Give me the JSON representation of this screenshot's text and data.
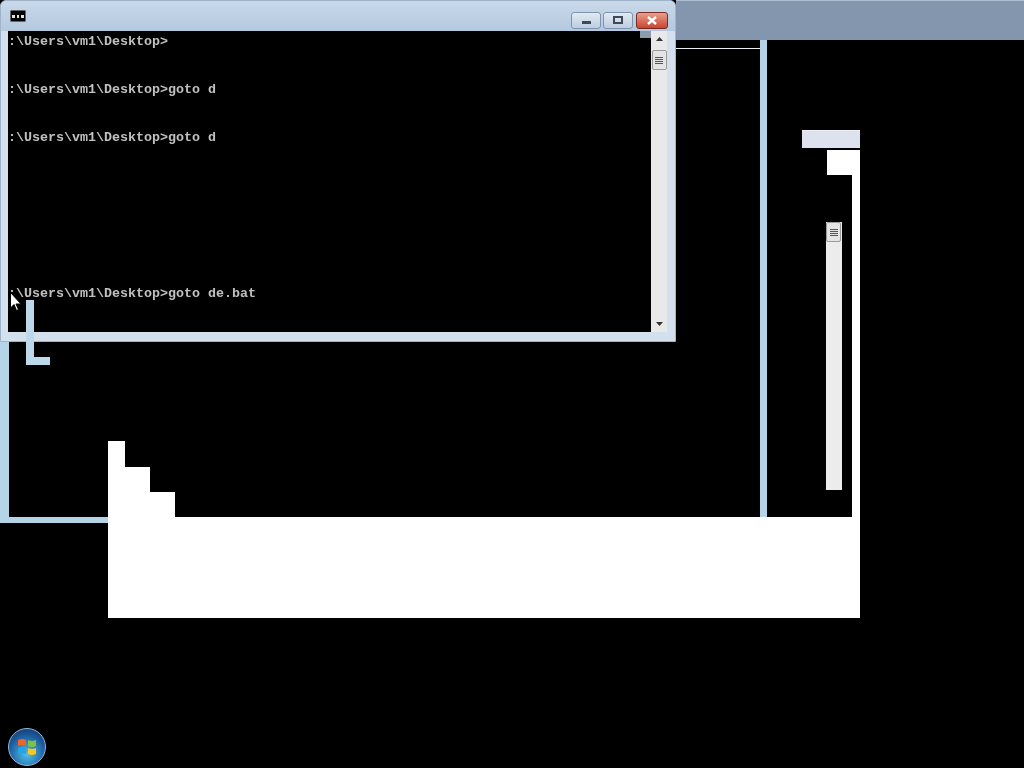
{
  "console_window": {
    "lines": [
      ":\\Users\\vm1\\Desktop>",
      ":\\Users\\vm1\\Desktop>goto d",
      ":\\Users\\vm1\\Desktop>goto d",
      ":\\Users\\vm1\\Desktop>goto de.bat"
    ]
  }
}
